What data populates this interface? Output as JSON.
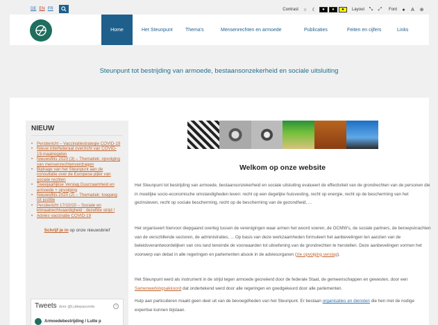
{
  "languages": [
    {
      "code": "DE",
      "active": false
    },
    {
      "code": "EN",
      "active": true
    },
    {
      "code": "FR",
      "active": false
    }
  ],
  "tools": {
    "contrast_label": "Contrast",
    "layout_label": "Layout",
    "font_label": "Font"
  },
  "nav": {
    "items": [
      "Home",
      "Het Steunpunt",
      "Thema's",
      "Mensenrechten en armoede",
      "Publicaties",
      "Feiten en cijfers",
      "Links"
    ]
  },
  "tagline": "Steunpunt tot bestrijding van armoede, bestaansonzekerheid en sociale uitsluiting",
  "sidebar": {
    "title": "NIEUW",
    "news": [
      "Persbericht – Vaccinatiestrategie COVID-19",
      "Nieuw interfederaal overzicht van COVID-19-maatregelen",
      "Nieuwsflits 2020 (3) – Thematiek: opvolging van mensenrechtenverdragen",
      "Bijdrage van het Steunpunt aan de consultatie over de Europese pijler van sociale rechten",
      "Tweejaarlijkse Verslag Duurzaamheid en armoede + opvolging",
      "Nieuwsflits 2020 (2) – Thematiek: toegang tot justitie",
      "Persbericht 17/10/20 – Sociale en klimaatrechtvaardigheid : dezelfde strijd !",
      "Advies vaccinatie COVID-19"
    ],
    "subscribe_link": "Schrijf je in",
    "subscribe_rest": " op onze nieuwsbrief",
    "tweets_title": "Tweets",
    "tweets_by": "door @Luttepauvrete",
    "tweet_author": "Armoedebestrijding / Lutte p"
  },
  "main": {
    "welcome": "Welkom op onze website",
    "p1": "Het Steunpunt tot bestrijding van armoede, bestaansonzekerheid en sociale uitsluiting evalueert de effectiviteit van de grondrechten van de personen die in moeilijke socio-economische omstandigheden leven: recht op een degelijke huisvesting, recht op energie, recht op de bescherming van het gezinsleven, recht op sociale bescherming, recht op de bescherming van de gezondheid, ...",
    "p2_a": "Het organiseert hiervoor diepgaand overleg tussen de verenigingen waar armen het woord voeren, de OCMW's, de sociale partners, de beroepskrachten van de verschillende sectoren, de administraties, ... Op basis van deze werkzaamheden formuleert het aanbevelingen ten aanzien van de beleidsverantwoordelijken van ons land teneinde de voorwaarden tot uitoefening van de grondrechten te herstellen. Deze aanbevelingen vormen het voorwerp van debat in alle regeringen en parlementen alsook in de adviesorganen (",
    "p2_link": "zie opvolging verslag",
    "p2_b": ").",
    "p3_a": "Het Steunpunt werd als instrument in de strijd tegen armoede gecreëerd door de federale Staat, de gemeenschappen en gewesten, door een ",
    "p3_link": "Samenwerkingsakkoord",
    "p3_b": " dat ondertekend werd door alle regeringen en goedgekeurd door alle parlementen.",
    "p4_a": "Hulp aan particulieren maakt geen deel uit van de bevoegdheden van het Steunpunt. Er bestaan ",
    "p4_link": "organisaties en diensten",
    "p4_b": " die hen met de nodige expertise kunnen bijstaan."
  },
  "colors": {
    "brand_blue": "#1f5f8b",
    "link_orange": "#c0632b",
    "logo_green": "#1f6e5e"
  }
}
